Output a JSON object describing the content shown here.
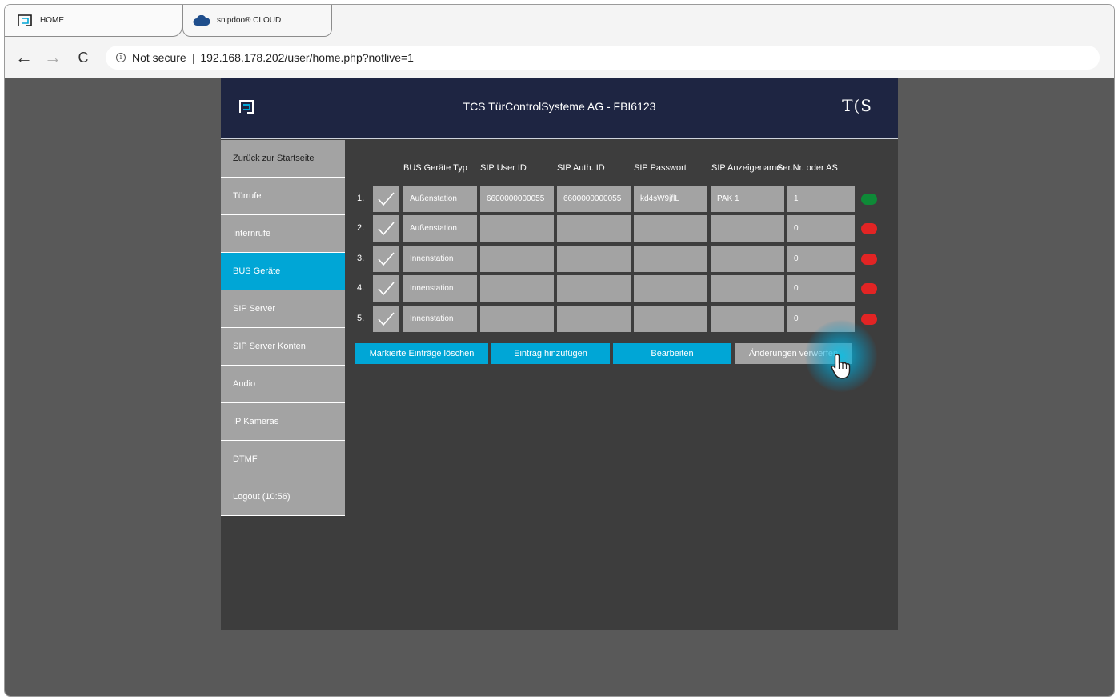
{
  "browser": {
    "tabs": [
      {
        "label": "HOME",
        "icon": "home-app-icon"
      },
      {
        "label": "snipdoo® CLOUD",
        "icon": "cloud-icon"
      }
    ],
    "nav": {
      "back": "←",
      "forward": "→",
      "reload": "C"
    },
    "security": "Not secure",
    "security_icon": "info-icon",
    "separator": "|",
    "url": "192.168.178.202/user/home.php?notlive=1"
  },
  "app": {
    "title": "TCS TürControlSysteme AG - FBI6123",
    "brand": "TCS",
    "brand_display": "T(S"
  },
  "sidebar": {
    "items": [
      {
        "label": "Zurück zur Startseite"
      },
      {
        "label": "Türrufe"
      },
      {
        "label": "Internrufe"
      },
      {
        "label": "BUS Geräte",
        "active": true
      },
      {
        "label": "SIP Server"
      },
      {
        "label": "SIP Server Konten"
      },
      {
        "label": "Audio"
      },
      {
        "label": "IP Kameras"
      },
      {
        "label": "DTMF"
      },
      {
        "label": "Logout (10:56)"
      }
    ]
  },
  "table": {
    "headers": [
      "BUS Geräte Typ",
      "SIP User ID",
      "SIP Auth. ID",
      "SIP Passwort",
      "SIP Anzeigename",
      "Ser.Nr. oder AS"
    ],
    "rows": [
      {
        "num": "1.",
        "checked": true,
        "type": "Außenstation",
        "sip_user_id": "6600000000055",
        "sip_auth_id": "6600000000055",
        "sip_password": "kd4sW9jflL",
        "display_name": "PAK 1",
        "serial": "1",
        "status": "online",
        "status_color": "#0e8a37"
      },
      {
        "num": "2.",
        "checked": true,
        "type": "Außenstation",
        "sip_user_id": "",
        "sip_auth_id": "",
        "sip_password": "",
        "display_name": "",
        "serial": "0",
        "status": "offline",
        "status_color": "#e22424"
      },
      {
        "num": "3.",
        "checked": true,
        "type": "Innenstation",
        "sip_user_id": "",
        "sip_auth_id": "",
        "sip_password": "",
        "display_name": "",
        "serial": "0",
        "status": "offline",
        "status_color": "#e22424"
      },
      {
        "num": "4.",
        "checked": true,
        "type": "Innenstation",
        "sip_user_id": "",
        "sip_auth_id": "",
        "sip_password": "",
        "display_name": "",
        "serial": "0",
        "status": "offline",
        "status_color": "#e22424"
      },
      {
        "num": "5.",
        "checked": true,
        "type": "Innenstation",
        "sip_user_id": "",
        "sip_auth_id": "",
        "sip_password": "",
        "display_name": "",
        "serial": "0",
        "status": "offline",
        "status_color": "#e22424"
      }
    ]
  },
  "actions": {
    "delete_label": "Markierte Einträge löschen",
    "add_label": "Eintrag hinzufügen",
    "edit_label": "Bearbeiten",
    "discard_label": "Änderungen verwerfen"
  },
  "colors": {
    "accent": "#00a6d6",
    "header_bg": "#1e2542",
    "content_bg": "#3d3d3d",
    "cell_bg": "#a3a3a3",
    "status_ok": "#0e8a37",
    "status_error": "#e22424"
  }
}
